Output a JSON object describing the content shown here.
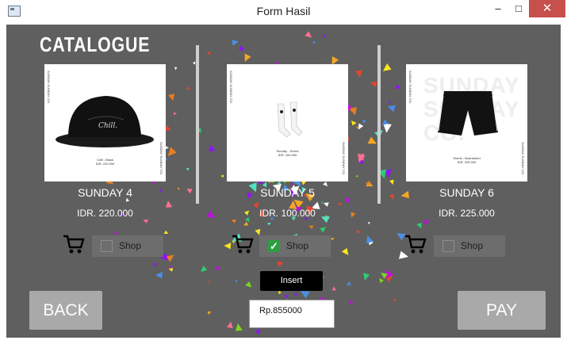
{
  "window": {
    "title": "Form Hasil",
    "minimize": "–",
    "maximize": "□",
    "close": "✕"
  },
  "heading": "CATALOGUE",
  "products": [
    {
      "name": "SUNDAY 4",
      "price": "IDR. 220.000",
      "shop_label": "Shop",
      "checked": false,
      "item_caption": "Chill - Black",
      "item_price": "IDR. 220.000"
    },
    {
      "name": "SUNDAY 5",
      "price": "IDR. 100.000",
      "shop_label": "Shop",
      "checked": true,
      "item_caption": "Sunday - Socks",
      "item_price": "IDR. 100.000"
    },
    {
      "name": "SUNDAY 6",
      "price": "IDR. 225.000",
      "shop_label": "Shop",
      "checked": false,
      "item_caption": "Shorts - Boardshort",
      "item_price": "IDR. 225.000"
    }
  ],
  "card_side_text": "SUNDAY SUNDAY CO.",
  "watermark": "SUNDAY SUNDAY CO.",
  "insert_label": "Insert",
  "back_label": "BACK",
  "pay_label": "PAY",
  "total_value": "Rp.855000",
  "colors": {
    "panel": "#5f5f5f",
    "close": "#c7504c",
    "check": "#2f9e42"
  }
}
